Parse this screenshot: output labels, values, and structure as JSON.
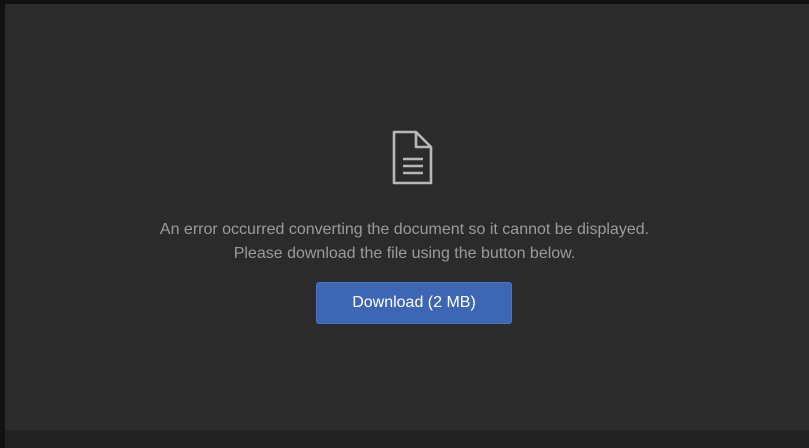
{
  "icon": "document-icon",
  "message": {
    "line1": "An error occurred converting the document so it cannot be displayed.",
    "line2": "Please download the file using the button below."
  },
  "download_button": {
    "label": "Download (2 MB)"
  },
  "colors": {
    "panel_background": "#2b2b2b",
    "outer_background": "#111111",
    "text": "#9b9b9b",
    "button": "#3d67b5",
    "icon": "#b8b8b8"
  }
}
